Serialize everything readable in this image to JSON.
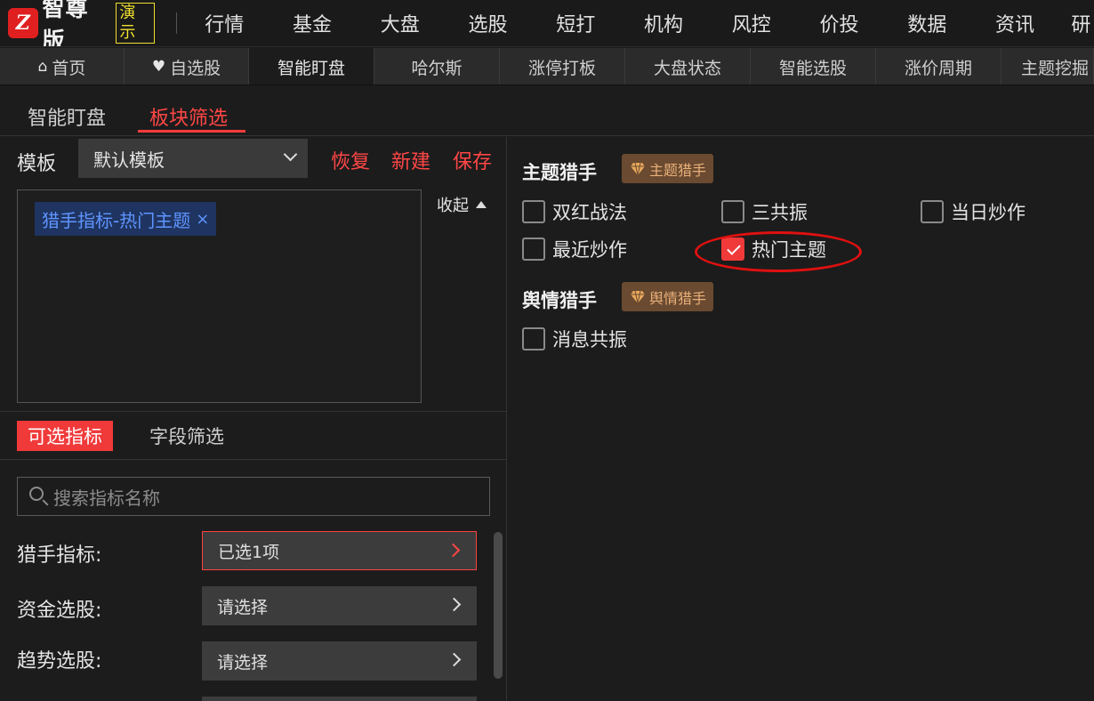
{
  "app": {
    "logo_text": "智尊版",
    "logo_tag": "演示",
    "logo_mark": "Z"
  },
  "top_nav": [
    "行情",
    "基金",
    "大盘",
    "选股",
    "短打",
    "机构",
    "风控",
    "价投",
    "数据",
    "资讯",
    "研"
  ],
  "sub_tabs": [
    {
      "label": "首页",
      "icon": "home-icon"
    },
    {
      "label": "自选股",
      "icon": "heart-icon"
    },
    {
      "label": "智能盯盘"
    },
    {
      "label": "哈尔斯"
    },
    {
      "label": "涨停打板"
    },
    {
      "label": "大盘状态"
    },
    {
      "label": "智能选股"
    },
    {
      "label": "涨价周期"
    },
    {
      "label": "主题挖掘"
    }
  ],
  "inner_tabs": {
    "tab1": "智能盯盘",
    "tab2": "板块筛选"
  },
  "template": {
    "label": "模板",
    "selected": "默认模板",
    "restore": "恢复",
    "new": "新建",
    "save": "保存",
    "collapse": "收起"
  },
  "chosen_chip": {
    "label": "猎手指标-热门主题",
    "remove": "×"
  },
  "filter_tabs": {
    "active": "可选指标",
    "other": "字段筛选"
  },
  "search": {
    "placeholder": "搜索指标名称"
  },
  "filter_rows": [
    {
      "label": "猎手指标:",
      "value": "已选1项"
    },
    {
      "label": "资金选股:",
      "value": "请选择"
    },
    {
      "label": "趋势选股:",
      "value": "请选择"
    }
  ],
  "sections": {
    "theme": {
      "title": "主题猎手",
      "badge": "主题猎手",
      "options": [
        {
          "label": "双红战法",
          "checked": false
        },
        {
          "label": "三共振",
          "checked": false
        },
        {
          "label": "当日炒作",
          "checked": false
        },
        {
          "label": "最近炒作",
          "checked": false
        },
        {
          "label": "热门主题",
          "checked": true
        }
      ]
    },
    "sentiment": {
      "title": "舆情猎手",
      "badge": "舆情猎手",
      "options": [
        {
          "label": "消息共振",
          "checked": false
        }
      ]
    }
  },
  "colors": {
    "accent": "#f03a3a",
    "chip_bg": "#1f3461",
    "chip_text": "#5f95ff",
    "badge_bg": "#6a4a30"
  }
}
